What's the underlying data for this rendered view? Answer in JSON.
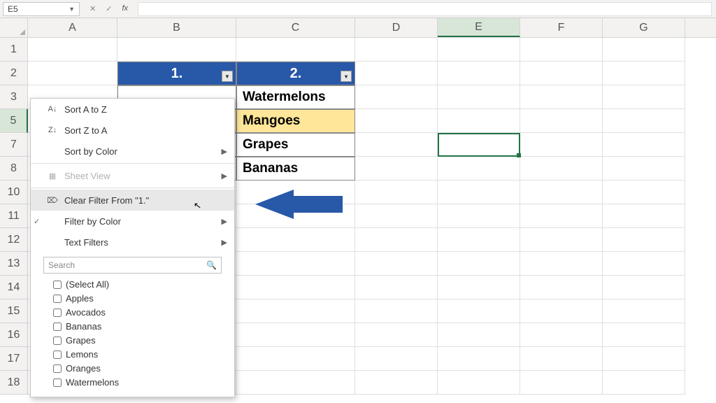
{
  "formulaBar": {
    "cellRef": "E5",
    "cancel": "✕",
    "confirm": "✓",
    "fx": "fx"
  },
  "columns": [
    "A",
    "B",
    "C",
    "D",
    "E",
    "F",
    "G"
  ],
  "visibleRowHeaders": [
    "1",
    "2",
    "3",
    "5",
    "7",
    "8",
    "10",
    "11",
    "12",
    "13",
    "14",
    "15",
    "16",
    "17",
    "18"
  ],
  "tableHeaders": {
    "col1": "1.",
    "col2": "2."
  },
  "tableData": {
    "r3": "Watermelons",
    "r5": "Mangoes",
    "r7": "Grapes",
    "r8": "Bananas"
  },
  "menu": {
    "sortAZ": "Sort A to Z",
    "sortZA": "Sort Z to A",
    "sortColor": "Sort by Color",
    "sheetView": "Sheet View",
    "clearFilter": "Clear Filter From \"1.\"",
    "filterColor": "Filter by Color",
    "textFilters": "Text Filters",
    "searchPlaceholder": "Search",
    "options": [
      "(Select All)",
      "Apples",
      "Avocados",
      "Bananas",
      "Grapes",
      "Lemons",
      "Oranges",
      "Watermelons"
    ]
  },
  "colors": {
    "headerBlue": "#2858a8",
    "highlight": "#ffe699",
    "excelGreen": "#217346"
  }
}
